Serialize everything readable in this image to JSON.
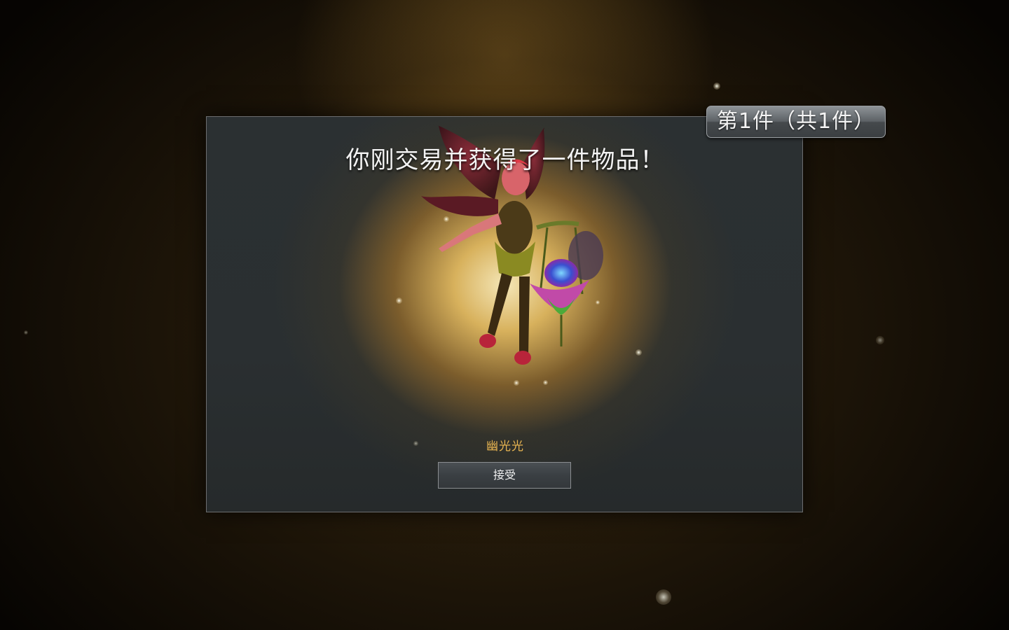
{
  "dialog": {
    "title": "你刚交易并获得了一件物品！",
    "item_name": "幽光光",
    "accept_label": "接受"
  },
  "counter": {
    "label": "第1件（共1件）"
  },
  "hero": {
    "icon": "fairy-hero-icon"
  },
  "colors": {
    "item_name": "#e7b451",
    "glow": "#f6c864",
    "dialog_bg": "#2b3032"
  }
}
